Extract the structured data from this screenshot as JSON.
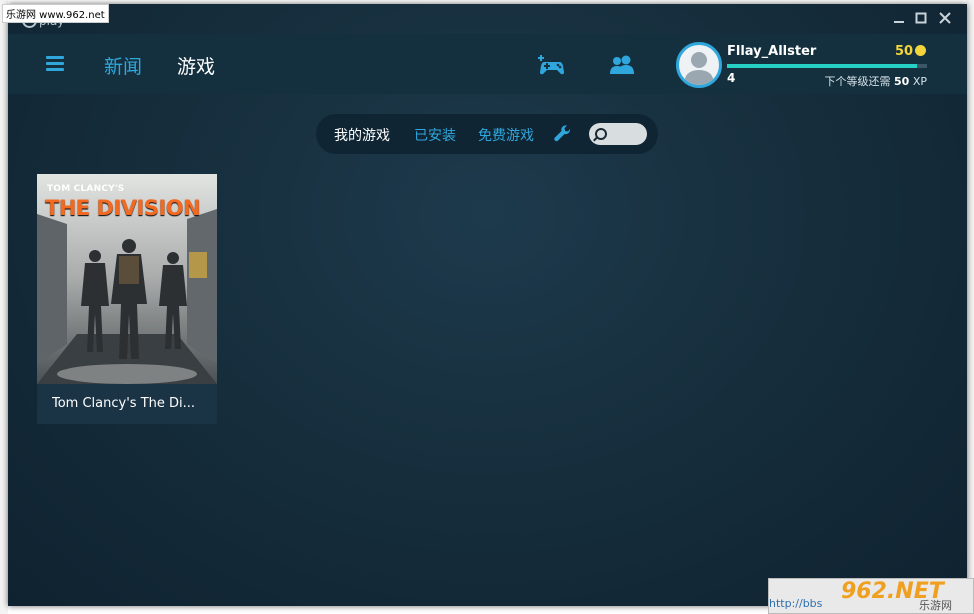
{
  "watermark": {
    "top_text": "乐游网 www.962.net",
    "bottom_logo": "962.NET",
    "bottom_site": "乐游网",
    "bottom_url": "http://bbs"
  },
  "window": {
    "logo_text": "play"
  },
  "header": {
    "nav": [
      {
        "label": "新闻"
      },
      {
        "label": "游戏"
      }
    ],
    "user": {
      "name": "Fllay_Allster",
      "level": "4",
      "coins": "50",
      "xp_fraction": 0.95,
      "xp_next_label": "下个等级还需",
      "xp_next_value": "50",
      "xp_unit": "XP"
    }
  },
  "filters": {
    "my_games": "我的游戏",
    "installed": "已安装",
    "free_games": "免费游戏",
    "search_placeholder": ""
  },
  "games": [
    {
      "title": "Tom Clancy's The Di...",
      "cover_brand": "TOM CLANCY'S",
      "cover_title": "THE DIVISION"
    }
  ],
  "colors": {
    "accent": "#2fa7dd",
    "xp": "#27d0c4",
    "coin": "#f3d43b"
  }
}
